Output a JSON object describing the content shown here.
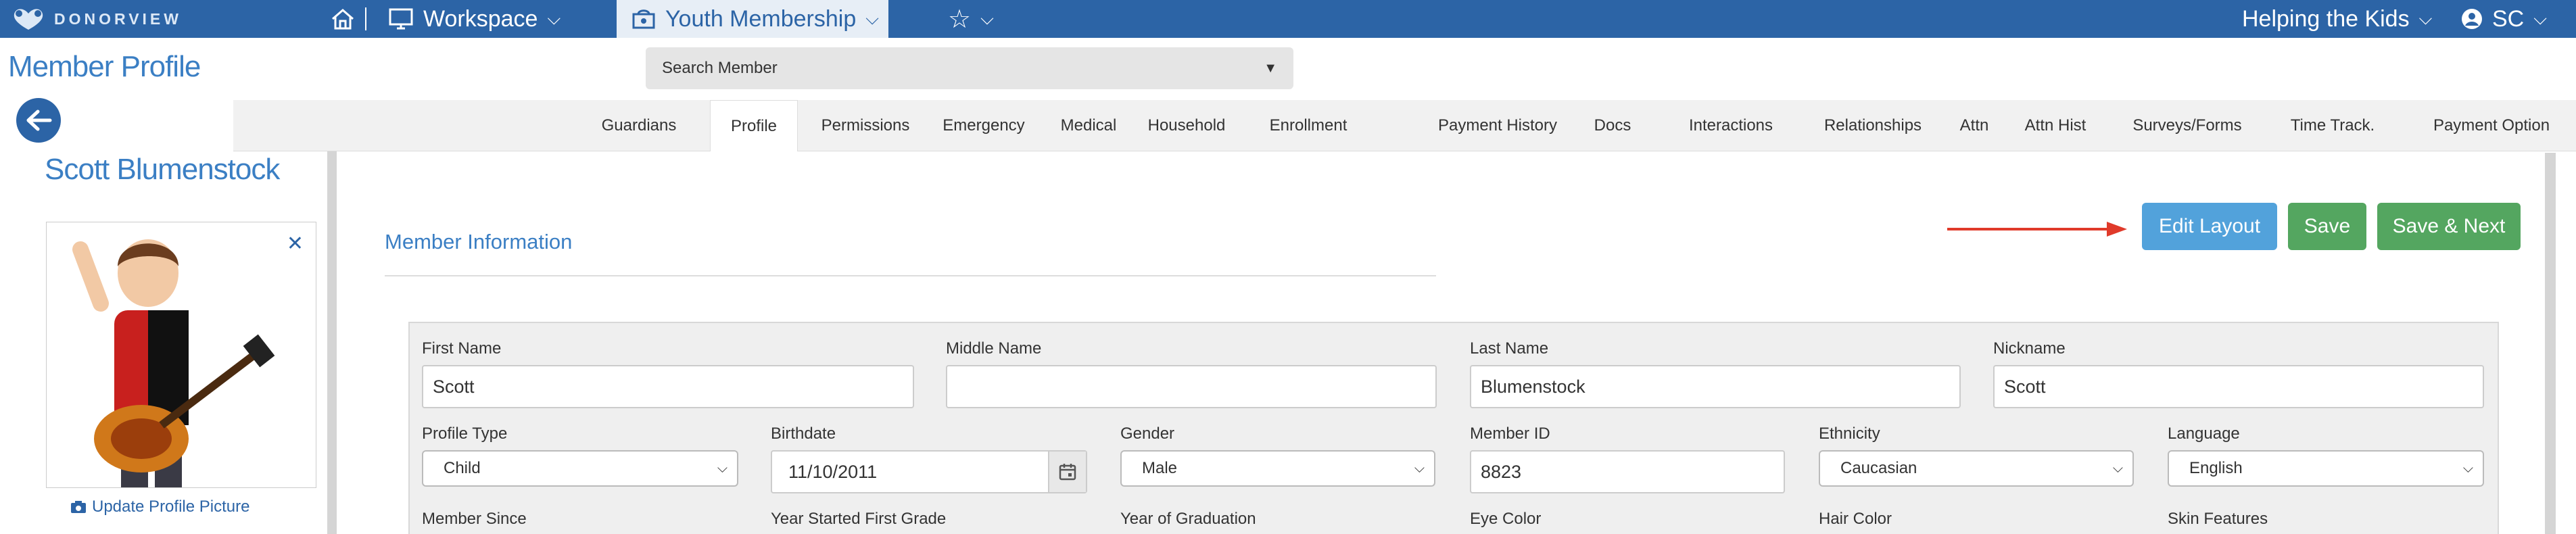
{
  "brand": {
    "name": "DONORVIEW"
  },
  "topnav": {
    "workspace": "Workspace",
    "module": "Youth Membership",
    "org": "Helping the Kids",
    "user": "SC"
  },
  "page": {
    "title": "Member Profile",
    "search_placeholder": "Search Member"
  },
  "tabs": [
    "Guardians",
    "Profile",
    "Permissions",
    "Emergency",
    "Medical",
    "Household",
    "Enrollment",
    "Payment History",
    "Docs",
    "Interactions",
    "Relationships",
    "Attn",
    "Attn Hist",
    "Surveys/Forms",
    "Time Track.",
    "Payment Option"
  ],
  "active_tab": "Profile",
  "member": {
    "name": "Scott Blumenstock",
    "update_picture": "Update Profile Picture"
  },
  "section": {
    "title": "Member Information"
  },
  "buttons": {
    "edit_layout": "Edit Layout",
    "save": "Save",
    "save_next": "Save & Next"
  },
  "form": {
    "first_name": {
      "label": "First Name",
      "value": "Scott"
    },
    "middle_name": {
      "label": "Middle Name",
      "value": ""
    },
    "last_name": {
      "label": "Last Name",
      "value": "Blumenstock"
    },
    "nickname": {
      "label": "Nickname",
      "value": "Scott"
    },
    "profile_type": {
      "label": "Profile Type",
      "value": "Child"
    },
    "birthdate": {
      "label": "Birthdate",
      "value": "11/10/2011"
    },
    "gender": {
      "label": "Gender",
      "value": "Male"
    },
    "member_id": {
      "label": "Member ID",
      "value": "8823"
    },
    "ethnicity": {
      "label": "Ethnicity",
      "value": "Caucasian"
    },
    "language": {
      "label": "Language",
      "value": "English"
    },
    "member_since": {
      "label": "Member Since"
    },
    "year_first_grade": {
      "label": "Year Started First Grade"
    },
    "year_graduation": {
      "label": "Year of Graduation"
    },
    "eye_color": {
      "label": "Eye Color"
    },
    "hair_color": {
      "label": "Hair Color"
    },
    "skin_features": {
      "label": "Skin Features"
    }
  },
  "colors": {
    "primary": "#2c64a6",
    "link": "#3b7fc4",
    "edit_button": "#52a2db",
    "save_button": "#54a660",
    "annotation_arrow": "#e03a2a"
  }
}
